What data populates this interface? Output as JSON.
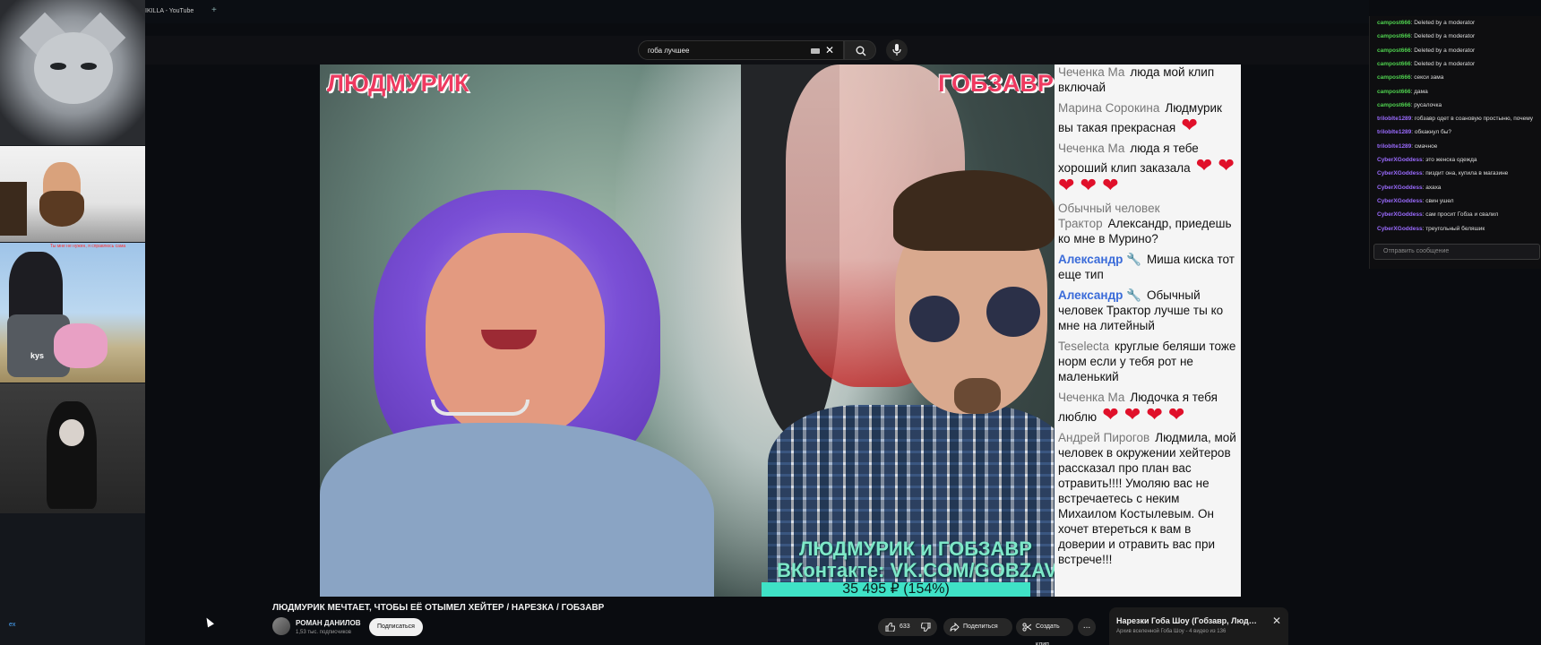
{
  "browser": {
    "tab_title": "IKILLA - YouTube"
  },
  "search": {
    "query": "гоба лучшее"
  },
  "left_panel": {
    "anime_tag": "Ты мне не нужен, я справлюсь сама",
    "anime_shirt": "kys",
    "footer": "ex"
  },
  "video": {
    "overlay_left": "ЛЮДМУРИК",
    "overlay_right": "ГОБЗАВР",
    "promo_line1": "ЛЮДМУРИК и ГОБЗАВР",
    "promo_line2": "ВКонтакте: VK.COM/GOBZAVR",
    "goal": "35 495 ₽ (154%)",
    "goal_fraction": 1.0,
    "chat": [
      {
        "author": "Чеченка Ма",
        "text": "люда мой клип включай",
        "hearts": 0,
        "style": "gray"
      },
      {
        "author": "Марина Сорокина",
        "text": "Людмурик вы такая прекрасная",
        "hearts": 1,
        "style": "gray"
      },
      {
        "author": "Чеченка Ма",
        "text": "люда я тебе хороший клип заказала",
        "hearts": 5,
        "style": "gray"
      },
      {
        "author": "Обычный человек Трактор",
        "text": "Александр, приедешь ко мне в Мурино?",
        "hearts": 0,
        "style": "gray"
      },
      {
        "author": "Александр 🔧",
        "text": "Миша киска тот еще тип",
        "hearts": 0,
        "style": "blue"
      },
      {
        "author": "Александр 🔧",
        "text": "Обычный человек Трактор лучше ты ко мне на литейный",
        "hearts": 0,
        "style": "blue"
      },
      {
        "author": "Teselecta",
        "text": "круглые беляши тоже норм если у тебя рот не маленький",
        "hearts": 0,
        "style": "gray"
      },
      {
        "author": "Чеченка Ма",
        "text": "Людочка я тебя люблю",
        "hearts": 4,
        "style": "gray"
      },
      {
        "author": "Андрей Пирогов",
        "text": "Людмила, мой человек в окружении хейтеров рассказал про план вас отравить!!!! Умоляю вас не встречаетесь с неким Михаилом Костылевым. Он хочет втереться к вам в доверии и отравить вас при встрече!!!",
        "hearts": 0,
        "style": "gray"
      }
    ]
  },
  "info": {
    "title": "ЛЮДМУРИК МЕЧТАЕТ, ЧТОБЫ ЕЁ ОТЫМЕЛ ХЕЙТЕР / НАРЕЗКА / ГОБЗАВР",
    "channel": "РОМАН ДАНИЛОВ",
    "subscribers": "1,53 тыс. подписчиков",
    "subscribe": "Подписаться",
    "likes": "633",
    "share": "Поделиться",
    "clip": "Создать клип",
    "more": "..."
  },
  "playlist": {
    "title": "Нарезки Гоба Шоу (Гобзавр, Людмурик...",
    "subtitle": "Архив вселенной Гоба Шоу - 4 видео из 136",
    "close": "✕"
  },
  "right_chat": {
    "messages": [
      {
        "user": "campost666",
        "text": "Deleted by a moderator",
        "color": "#4fd14f"
      },
      {
        "user": "campost666",
        "text": "Deleted by a moderator",
        "color": "#4fd14f"
      },
      {
        "user": "campost666",
        "text": "Deleted by a moderator",
        "color": "#4fd14f"
      },
      {
        "user": "campost666",
        "text": "Deleted by a moderator",
        "color": "#4fd14f"
      },
      {
        "user": "campost666",
        "text": "секси зама",
        "color": "#4fd14f"
      },
      {
        "user": "campost666",
        "text": "дама",
        "color": "#4fd14f"
      },
      {
        "user": "campost666",
        "text": "русалочка",
        "color": "#4fd14f"
      },
      {
        "user": "triloblte1289",
        "text": "гобзавр одет в соановую простыню, почему",
        "color": "#9b6bff"
      },
      {
        "user": "triloblte1289",
        "text": "обкакнул бы?",
        "color": "#9b6bff"
      },
      {
        "user": "triloblte1289",
        "text": "смачное",
        "color": "#9b6bff"
      },
      {
        "user": "CyberXGoddess",
        "text": "это женска одежда",
        "color": "#9b6bff"
      },
      {
        "user": "CyberXGoddess",
        "text": "пиздит она, купила в магазине",
        "color": "#9b6bff"
      },
      {
        "user": "CyberXGoddess",
        "text": "ахаха",
        "color": "#9b6bff"
      },
      {
        "user": "CyberXGoddess",
        "text": "свин ушел",
        "color": "#9b6bff"
      },
      {
        "user": "CyberXGoddess",
        "text": "сам просит Гобза и свалил",
        "color": "#9b6bff"
      },
      {
        "user": "CyberXGoddess",
        "text": "треугольный беляшик",
        "color": "#9b6bff"
      }
    ],
    "input_placeholder": "Отправить сообщение"
  }
}
